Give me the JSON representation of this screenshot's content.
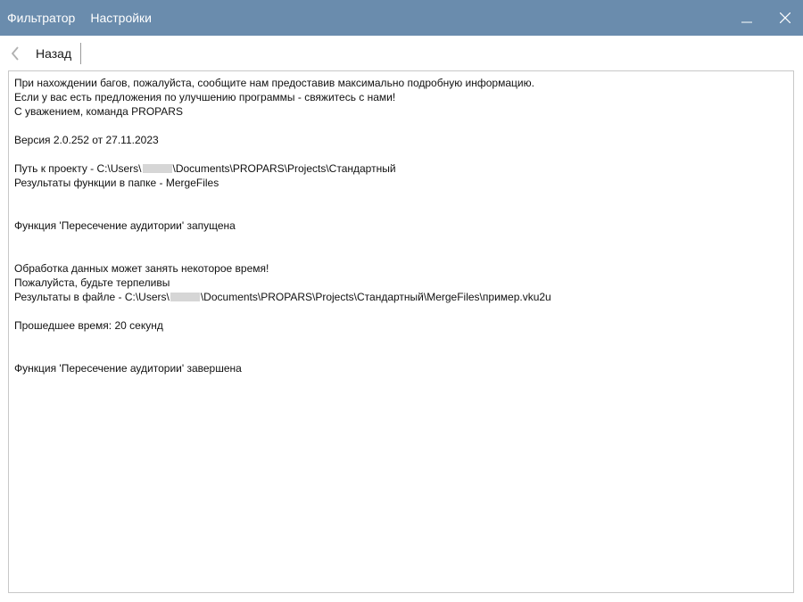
{
  "titlebar": {
    "menu": [
      "Фильтратор",
      "Настройки"
    ],
    "minimize_icon": "minimize-icon",
    "close_icon": "close-icon",
    "background": "#6a8cad"
  },
  "toolbar": {
    "back_icon": "chevron-left-icon",
    "back_label": "Назад"
  },
  "log": {
    "lines": [
      "При нахождении багов, пожалуйста, сообщите нам предоставив максимально подробную информацию.",
      "Если у вас есть предложения по улучшению программы - свяжитесь с нами!",
      "С уважением, команда PROPARS",
      "",
      "Версия 2.0.252 от 27.11.2023",
      "",
      "Путь к проекту - C:\\Users\\[redacted]\\Documents\\PROPARS\\Projects\\Стандартный",
      "Результаты функции в папке - MergeFiles",
      "",
      "",
      "Функция 'Пересечение аудитории' запущена",
      "",
      "",
      "Обработка данных может занять некоторое время!",
      "Пожалуйста, будьте терпеливы",
      "Результаты в файле - C:\\Users\\[redacted]\\Documents\\PROPARS\\Projects\\Стандартный\\MergeFiles\\пример.vku2u",
      "",
      "Прошедшее время: 20 секунд",
      "",
      "",
      "Функция 'Пересечение аудитории' завершена"
    ]
  }
}
